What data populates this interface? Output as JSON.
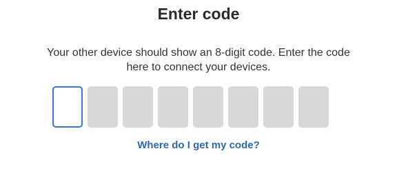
{
  "title": "Enter code",
  "description": {
    "line1": "Your other device should show an 8-digit code. Enter the code",
    "line2": "here to connect your devices."
  },
  "code_inputs": {
    "count": 8,
    "values": [
      "",
      "",
      "",
      "",
      "",
      "",
      "",
      ""
    ],
    "active_index": 0,
    "active_border_color": "#3a78c9",
    "inactive_fill_color": "#d8d8d8"
  },
  "help_link": {
    "label": "Where do I get my code?",
    "color": "#2f68b7"
  }
}
